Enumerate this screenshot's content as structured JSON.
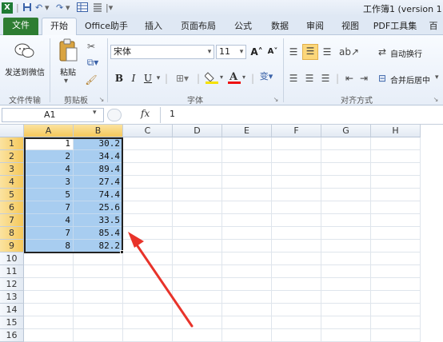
{
  "app": {
    "window_title": "工作簿1 (version 1"
  },
  "quick_access": {
    "save_icon": "save-icon",
    "undo_icon": "undo-icon",
    "redo_icon": "redo-icon",
    "more": "▾"
  },
  "tabs": [
    {
      "label": "文件"
    },
    {
      "label": "开始"
    },
    {
      "label": "Office助手"
    },
    {
      "label": "插入"
    },
    {
      "label": "页面布局"
    },
    {
      "label": "公式"
    },
    {
      "label": "数据"
    },
    {
      "label": "审阅"
    },
    {
      "label": "视图"
    },
    {
      "label": "PDF工具集"
    },
    {
      "label": "百"
    }
  ],
  "ribbon": {
    "wechat_label": "发送到微信",
    "paste_label": "粘贴",
    "font_name": "宋体",
    "font_size": "11",
    "bold": "B",
    "italic": "I",
    "underline": "U",
    "grow_font": "A˄",
    "shrink_font": "A˅",
    "wrap_text": "自动换行",
    "merge_center": "合并后居中",
    "groups": {
      "file_transfer": "文件传输",
      "clipboard": "剪贴板",
      "font": "字体",
      "alignment": "对齐方式"
    }
  },
  "formula_bar": {
    "name_box": "A1",
    "fx": "fx",
    "value": "1"
  },
  "sheet": {
    "columns": [
      "A",
      "B",
      "C",
      "D",
      "E",
      "F",
      "G",
      "H"
    ],
    "rows": [
      "1",
      "2",
      "3",
      "4",
      "5",
      "6",
      "7",
      "8",
      "9",
      "10",
      "11",
      "12",
      "13",
      "14",
      "15",
      "16"
    ],
    "data": [
      [
        "1",
        "30.2"
      ],
      [
        "2",
        "34.4"
      ],
      [
        "4",
        "89.4"
      ],
      [
        "3",
        "27.4"
      ],
      [
        "5",
        "74.4"
      ],
      [
        "7",
        "25.6"
      ],
      [
        "4",
        "33.5"
      ],
      [
        "7",
        "85.4"
      ],
      [
        "8",
        "82.2"
      ]
    ]
  },
  "annotation_color": "#e8332a"
}
